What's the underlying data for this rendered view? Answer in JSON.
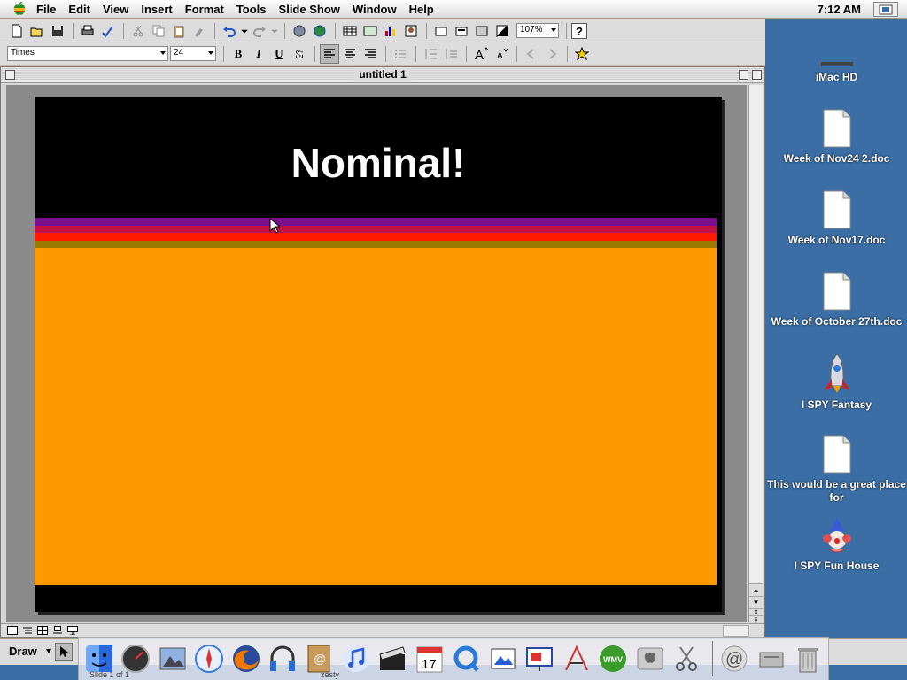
{
  "menubar": {
    "items": [
      "File",
      "Edit",
      "View",
      "Insert",
      "Format",
      "Tools",
      "Slide Show",
      "Window",
      "Help"
    ],
    "clock": "7:12 AM"
  },
  "toolbar": {
    "zoom": "107%",
    "font_name": "Times",
    "font_size": "24",
    "bold": "B",
    "italic": "I",
    "underline": "U",
    "shadow": "S"
  },
  "window": {
    "title": "untitled 1"
  },
  "slide": {
    "title": "Nominal!",
    "colors": {
      "background": "#000000",
      "stripe_purple": "#7a0e8a",
      "stripe_crimson": "#c0104a",
      "stripe_red": "#ff1a00",
      "stripe_olive": "#9a7a00",
      "body": "#ff9900"
    }
  },
  "status": {
    "slide_indicator": "Slide 1 of 1",
    "author": "zesty"
  },
  "drawbar": {
    "label": "Draw"
  },
  "desktop": {
    "icons": [
      {
        "label": "iMac HD",
        "icon": "hard-drive-icon"
      },
      {
        "label": "Week of Nov24 2.doc",
        "icon": "document-icon"
      },
      {
        "label": "Week of Nov17.doc",
        "icon": "document-icon"
      },
      {
        "label": "Week of October 27th.doc",
        "icon": "document-icon"
      },
      {
        "label": "I SPY Fantasy",
        "icon": "rocket-icon"
      },
      {
        "label": "This would be a great place for",
        "icon": "document-icon"
      },
      {
        "label": "I SPY Fun House",
        "icon": "clown-icon"
      }
    ]
  },
  "dock": {
    "wmv_label": "WMV"
  }
}
